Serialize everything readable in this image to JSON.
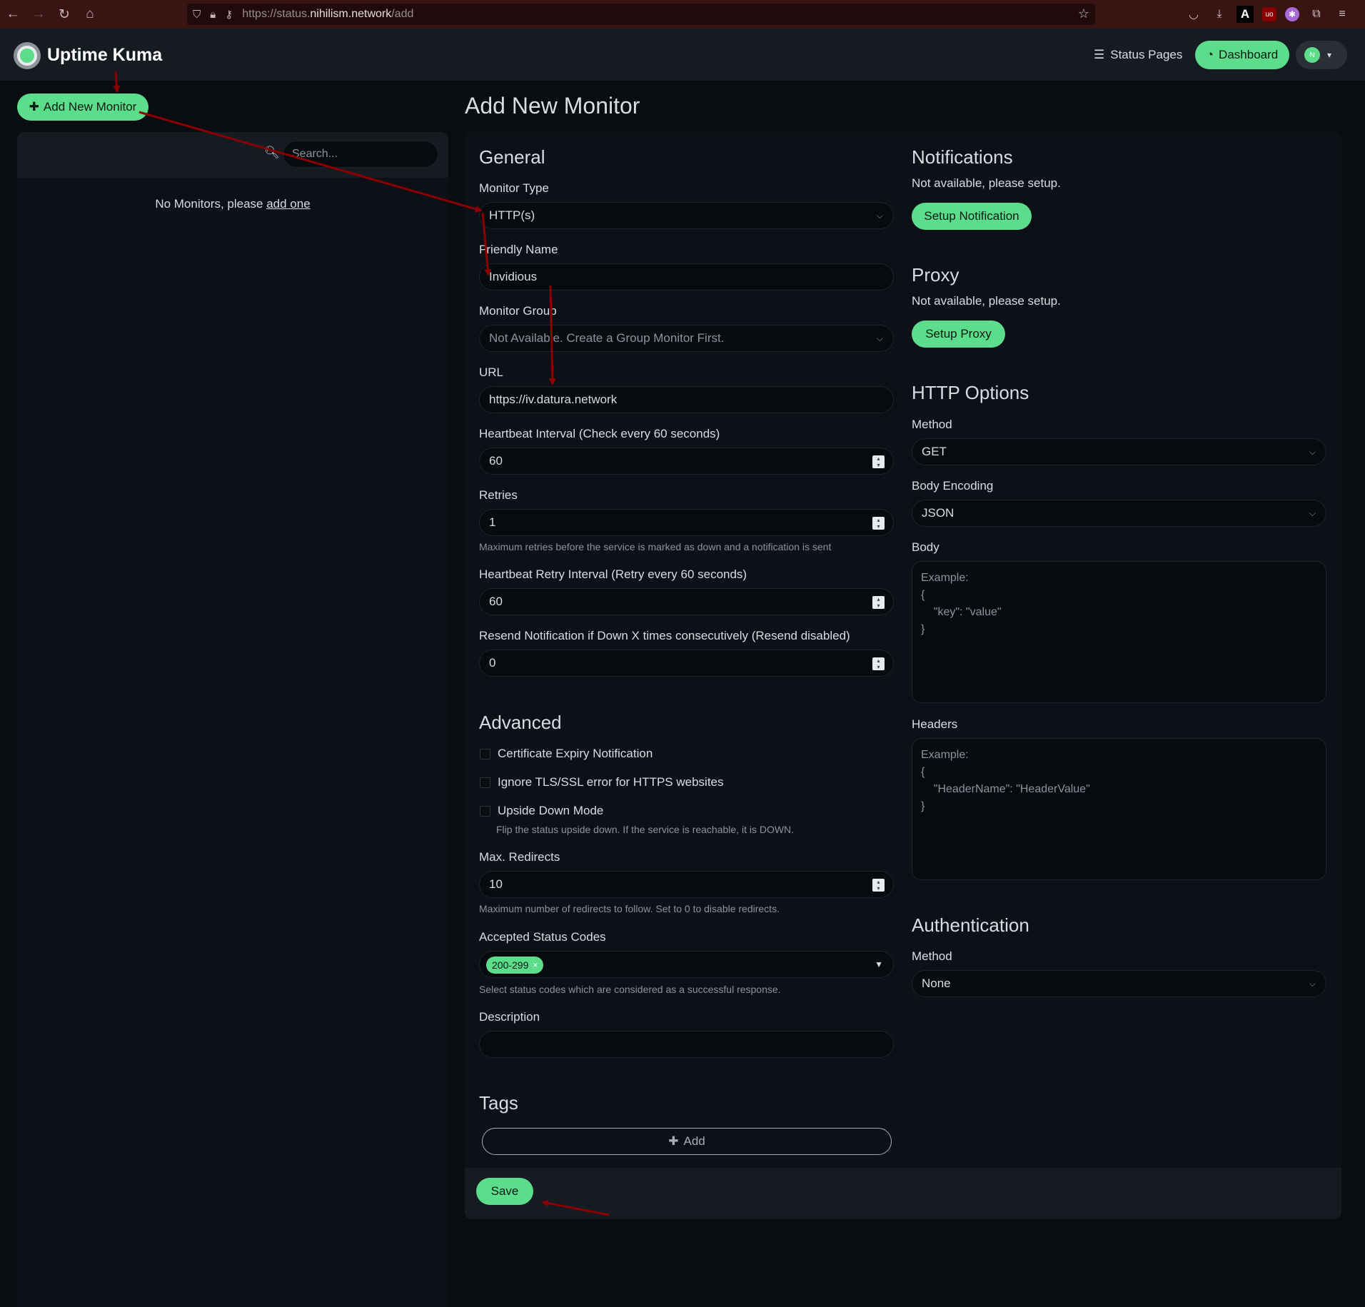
{
  "browser": {
    "url_prefix": "https://status.",
    "url_host": "nihilism.network",
    "url_path": "/add"
  },
  "header": {
    "brand": "Uptime Kuma",
    "status_pages": "Status Pages",
    "dashboard": "Dashboard",
    "avatar_initial": "N"
  },
  "sidebar": {
    "add_button": "Add New Monitor",
    "search_placeholder": "Search...",
    "empty_text": "No Monitors, please ",
    "empty_link": "add one"
  },
  "page_title": "Add New Monitor",
  "general": {
    "title": "General",
    "monitor_type_label": "Monitor Type",
    "monitor_type_value": "HTTP(s)",
    "friendly_name_label": "Friendly Name",
    "friendly_name_value": "Invidious",
    "monitor_group_label": "Monitor Group",
    "monitor_group_value": "Not Available. Create a Group Monitor First.",
    "url_label": "URL",
    "url_value": "https://iv.datura.network",
    "heartbeat_label": "Heartbeat Interval (Check every 60 seconds)",
    "heartbeat_value": "60",
    "retries_label": "Retries",
    "retries_value": "1",
    "retries_hint": "Maximum retries before the service is marked as down and a notification is sent",
    "retry_interval_label": "Heartbeat Retry Interval (Retry every 60 seconds)",
    "retry_interval_value": "60",
    "resend_label": "Resend Notification if Down X times consecutively (Resend disabled)",
    "resend_value": "0"
  },
  "advanced": {
    "title": "Advanced",
    "cert_expiry": "Certificate Expiry Notification",
    "ignore_tls": "Ignore TLS/SSL error for HTTPS websites",
    "upside_down": "Upside Down Mode",
    "upside_down_hint": "Flip the status upside down. If the service is reachable, it is DOWN.",
    "max_redirects_label": "Max. Redirects",
    "max_redirects_value": "10",
    "max_redirects_hint": "Maximum number of redirects to follow. Set to 0 to disable redirects.",
    "status_codes_label": "Accepted Status Codes",
    "status_code_tag": "200-299",
    "status_codes_hint": "Select status codes which are considered as a successful response.",
    "description_label": "Description",
    "description_value": ""
  },
  "tags": {
    "title": "Tags",
    "add_label": "Add"
  },
  "notifications": {
    "title": "Notifications",
    "text": "Not available, please setup.",
    "button": "Setup Notification"
  },
  "proxy": {
    "title": "Proxy",
    "text": "Not available, please setup.",
    "button": "Setup Proxy"
  },
  "http_options": {
    "title": "HTTP Options",
    "method_label": "Method",
    "method_value": "GET",
    "body_encoding_label": "Body Encoding",
    "body_encoding_value": "JSON",
    "body_label": "Body",
    "body_placeholder": "Example:\n{\n    \"key\": \"value\"\n}",
    "headers_label": "Headers",
    "headers_placeholder": "Example:\n{\n    \"HeaderName\": \"HeaderValue\"\n}"
  },
  "authentication": {
    "title": "Authentication",
    "method_label": "Method",
    "method_value": "None"
  },
  "footer": {
    "save": "Save"
  },
  "colors": {
    "accent": "#5cdd8b",
    "background": "#090c10",
    "panel": "#0d1117",
    "browser_bar": "#3a1313",
    "annotation_arrow": "#8b0000"
  }
}
